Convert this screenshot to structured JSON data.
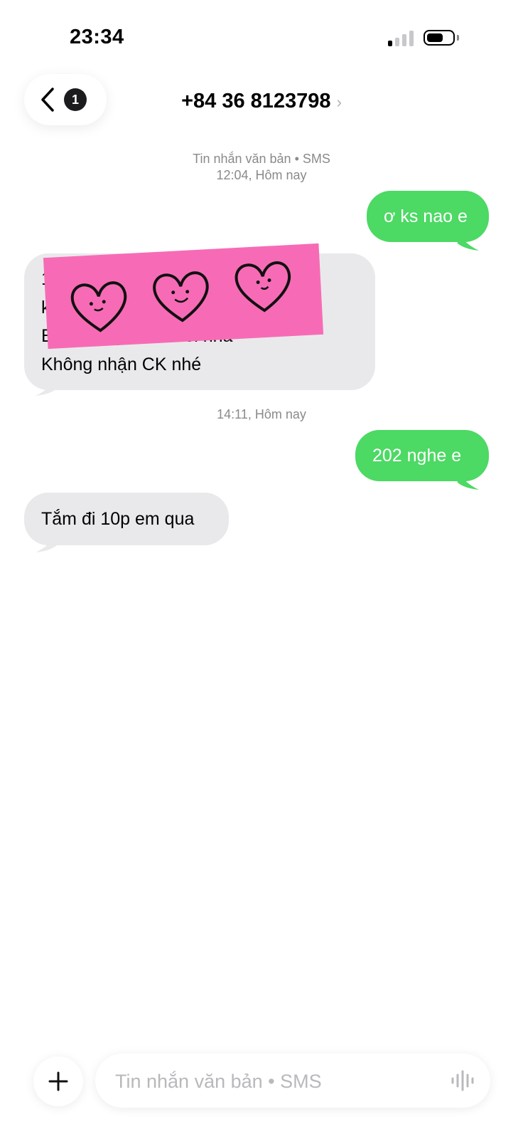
{
  "status_bar": {
    "time": "23:34"
  },
  "header": {
    "back_badge": "1",
    "contact": "+84 36 8123798"
  },
  "messages": [
    {
      "type": "meta",
      "line1": "Tin nhắn văn bản • SMS",
      "line2": "12:04, Hôm nay"
    },
    {
      "type": "out",
      "text": "ơ ks nao e"
    },
    {
      "type": "in",
      "text": "1                                          ,Q9\nk\nE                  người qua 30 tuổi nha\nKhông nhận CK nhé",
      "redacted": true
    },
    {
      "type": "meta",
      "line1": "14:11, Hôm nay"
    },
    {
      "type": "out",
      "text": "202 nghe e"
    },
    {
      "type": "in",
      "text": "Tắm đi 10p em qua"
    }
  ],
  "composer": {
    "placeholder": "Tin nhắn văn bản • SMS"
  },
  "colors": {
    "outgoing": "#4cd964",
    "incoming": "#e9e9eb",
    "censor": "#f76bb6"
  }
}
